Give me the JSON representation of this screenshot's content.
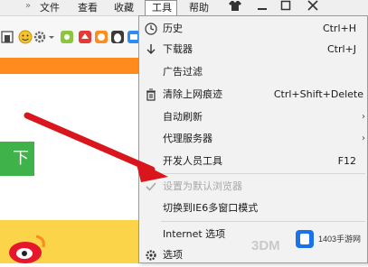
{
  "menubar": {
    "items": [
      "文件",
      "查看",
      "收藏",
      "工具",
      "帮助"
    ],
    "chevron": "»"
  },
  "dropdown": {
    "items": [
      {
        "label": "历史",
        "shortcut": "Ctrl+H",
        "icon": "history-clock-icon",
        "has_submenu": false,
        "disabled": false
      },
      {
        "label": "下载器",
        "shortcut": "Ctrl+J",
        "icon": "download-arrow-icon",
        "has_submenu": false,
        "disabled": false
      },
      {
        "label": "广告过滤",
        "shortcut": "",
        "icon": "",
        "has_submenu": false,
        "disabled": false
      },
      {
        "label": "清除上网痕迹",
        "shortcut": "Ctrl+Shift+Delete",
        "icon": "trash-icon",
        "has_submenu": false,
        "disabled": false
      },
      {
        "label": "自动刷新",
        "shortcut": "",
        "icon": "",
        "has_submenu": true,
        "disabled": false
      },
      {
        "label": "代理服务器",
        "shortcut": "",
        "icon": "",
        "has_submenu": true,
        "disabled": false
      },
      {
        "label": "开发人员工具",
        "shortcut": "F12",
        "icon": "",
        "has_submenu": false,
        "disabled": false
      },
      {
        "label": "设置为默认浏览器",
        "shortcut": "",
        "icon": "checkmark-icon",
        "has_submenu": false,
        "disabled": true
      },
      {
        "label": "切换到IE6多窗口模式",
        "shortcut": "",
        "icon": "",
        "has_submenu": false,
        "disabled": false
      },
      {
        "label": "Internet 选项",
        "shortcut": "",
        "icon": "",
        "has_submenu": false,
        "disabled": false
      },
      {
        "label": "选项",
        "shortcut": "",
        "icon": "gear-icon",
        "has_submenu": false,
        "disabled": false
      }
    ]
  },
  "page": {
    "green_button_label": "下"
  },
  "watermark": {
    "site_text": "1403手游网",
    "brand_3dm": "3DM"
  },
  "colors": {
    "accent_orange": "#ff8a1e",
    "button_green": "#3fb34a",
    "yellow_area": "#fbd44a",
    "annotation_arrow": "#d8161b"
  }
}
